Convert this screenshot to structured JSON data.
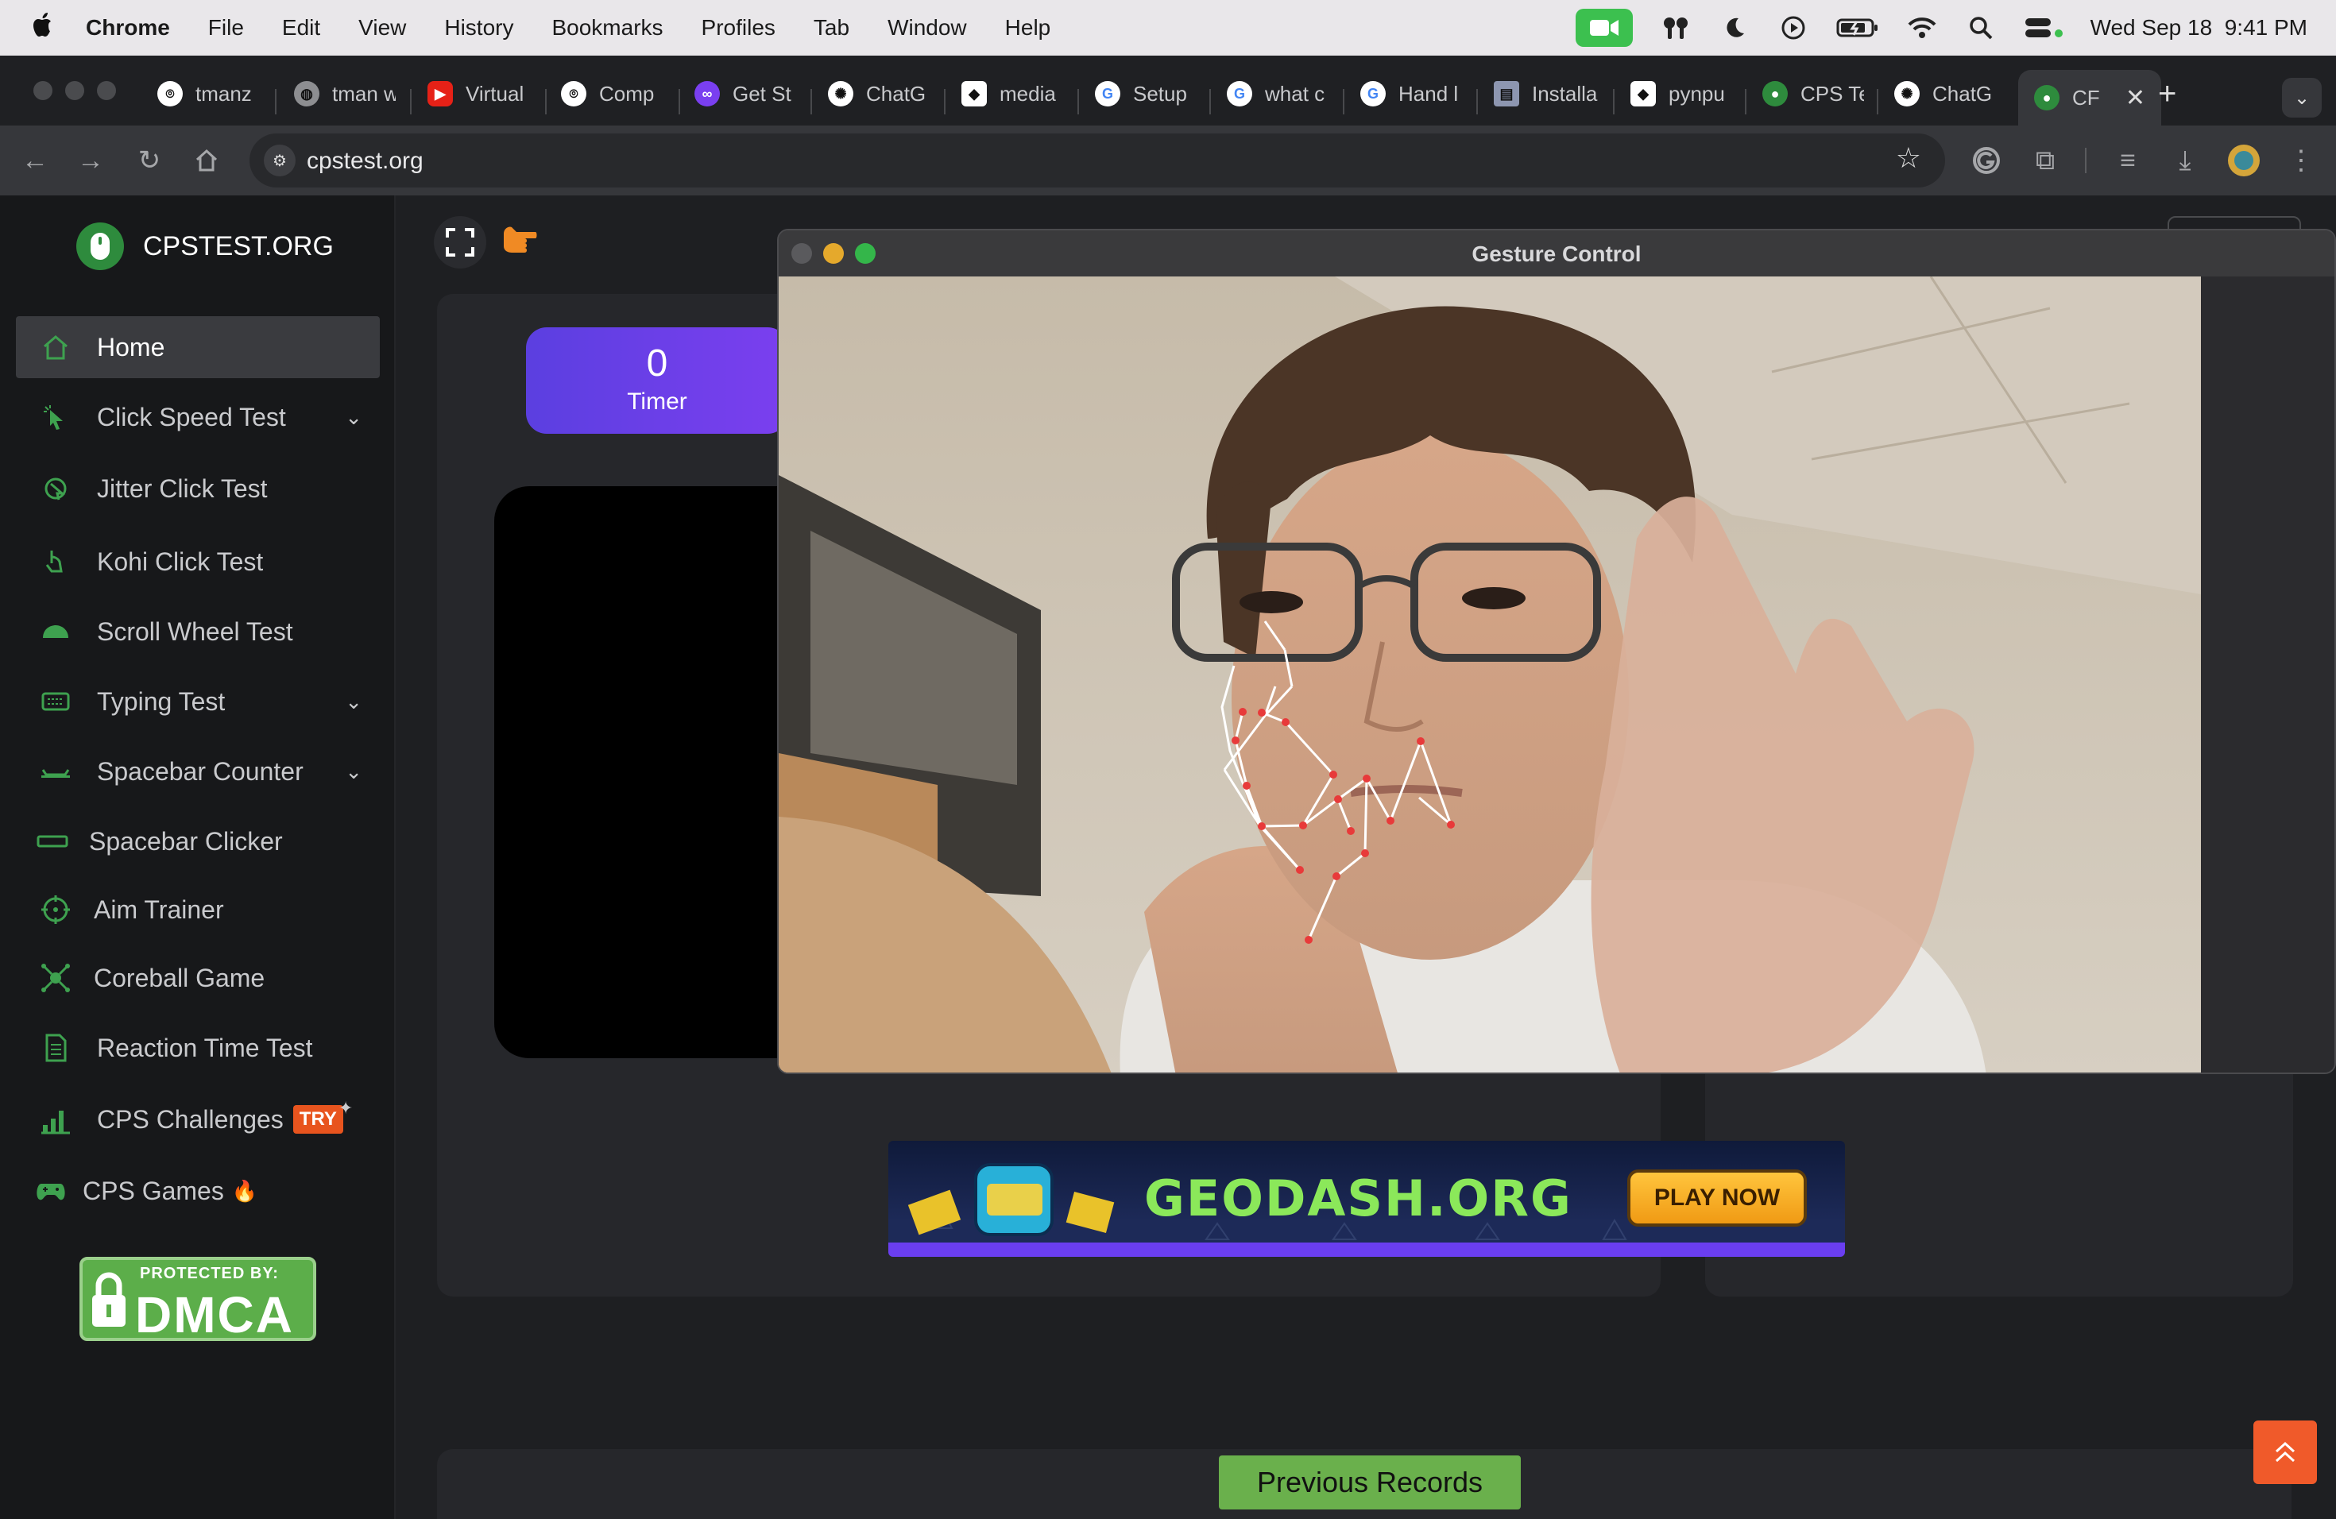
{
  "menubar": {
    "app": "Chrome",
    "items": [
      "File",
      "Edit",
      "View",
      "History",
      "Bookmarks",
      "Profiles",
      "Tab",
      "Window",
      "Help"
    ],
    "datetime": "Wed Sep 18  9:41 PM"
  },
  "tabs": [
    {
      "label": "tmanz",
      "icon": "github-icon"
    },
    {
      "label": "tman w",
      "icon": "globe-icon"
    },
    {
      "label": "Virtual",
      "icon": "youtube-icon"
    },
    {
      "label": "Comp",
      "icon": "github-icon"
    },
    {
      "label": "Get St",
      "icon": "app-icon"
    },
    {
      "label": "ChatG",
      "icon": "openai-icon"
    },
    {
      "label": "media",
      "icon": "cube-icon"
    },
    {
      "label": "Setup",
      "icon": "google-icon"
    },
    {
      "label": "what c",
      "icon": "google-icon"
    },
    {
      "label": "Hand l",
      "icon": "google-icon"
    },
    {
      "label": "Installa",
      "icon": "doc-icon"
    },
    {
      "label": "pynpu",
      "icon": "cube-icon"
    },
    {
      "label": "CPS Te",
      "icon": "mouse-icon"
    },
    {
      "label": "ChatG",
      "icon": "openai-icon"
    },
    {
      "label": "CF",
      "icon": "mouse-icon"
    }
  ],
  "address": {
    "url": "cpstest.org"
  },
  "site": {
    "brand": "CPSTEST.ORG",
    "nav": [
      {
        "label": "Home",
        "icon": "home-icon",
        "chevron": false
      },
      {
        "label": "Click Speed Test",
        "icon": "cursor-click-icon",
        "chevron": true
      },
      {
        "label": "Jitter Click Test",
        "icon": "jitter-icon",
        "chevron": false
      },
      {
        "label": "Kohi Click Test",
        "icon": "hand-pointer-icon",
        "chevron": false
      },
      {
        "label": "Scroll Wheel Test",
        "icon": "mouse-icon",
        "chevron": false
      },
      {
        "label": "Typing Test",
        "icon": "keyboard-icon",
        "chevron": true
      },
      {
        "label": "Spacebar Counter",
        "icon": "spacebar-icon",
        "chevron": true
      },
      {
        "label": "Spacebar Clicker",
        "icon": "spacebar-key-icon",
        "chevron": false
      },
      {
        "label": "Aim Trainer",
        "icon": "crosshair-icon",
        "chevron": false
      },
      {
        "label": "Coreball Game",
        "icon": "coreball-icon",
        "chevron": false
      },
      {
        "label": "Reaction Time Test",
        "icon": "document-icon",
        "chevron": false
      },
      {
        "label": "CPS Challenges",
        "icon": "chart-icon",
        "chevron": false,
        "badge": "TRY"
      },
      {
        "label": "CPS Games",
        "icon": "gamepad-icon",
        "chevron": false,
        "suffix": "🔥"
      }
    ],
    "dmca": {
      "line1": "PROTECTED BY:",
      "line2": "DMCA"
    },
    "timer": {
      "value": "0",
      "label": "Timer"
    },
    "banner": {
      "brand": "GEODASH.ORG",
      "cta": "PLAY NOW"
    },
    "records_button": "Previous Records"
  },
  "gesture_window": {
    "title": "Gesture Control"
  },
  "colors": {
    "accent_green": "#3ea14f",
    "timer_purple": "#6a3fe8",
    "records_green": "#6ab04c",
    "scroll_top_orange": "#f05a2a"
  }
}
